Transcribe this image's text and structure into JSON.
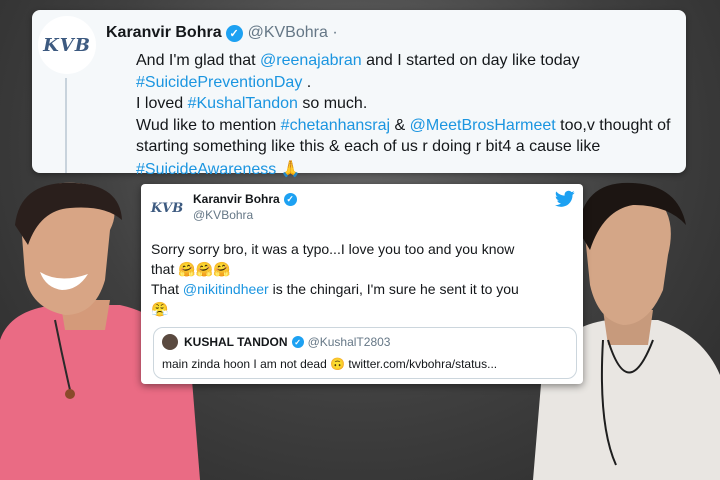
{
  "tweet_top": {
    "avatar_text": "KVB",
    "name": "Karanvir Bohra",
    "handle": "@KVBohra ·",
    "line1_a": "And I'm glad that ",
    "line1_mention": "@reenajabran",
    "line1_b": " and I started on day like today",
    "line2_hashtag": "#SuicidePreventionDay",
    "line2_b": " .",
    "line3_a": "I loved ",
    "line3_hashtag": "#KushalTandon",
    "line3_b": " so much.",
    "line4_a": "Wud like to mention ",
    "line4_hashtag": "#chetanhansraj",
    "line4_b": " & ",
    "line4_mention": "@MeetBrosHarmeet",
    "line4_c": " too,v thought of",
    "line5": "starting something like this & each of us r doing r bit4 a cause like",
    "line6_hashtag": "#SuicideAwareness",
    "line6_emoji": "🙏"
  },
  "tweet_mid": {
    "avatar_text": "KVB",
    "name": "Karanvir Bohra",
    "handle": "@KVBohra",
    "line1": "Sorry sorry bro, it was a typo...I love you too and you know",
    "line2_a": "that ",
    "line2_emojis": "🤗🤗🤗",
    "line3_a": "That ",
    "line3_mention": "@nikitindheer",
    "line3_b": " is the chingari, I'm sure he sent it to you",
    "line4_emoji": "😤",
    "quote": {
      "name": "KUSHAL TANDON",
      "handle": "@KushalT2803",
      "text": "main zinda hoon I am not dead 🙃 twitter.com/kvbohra/status..."
    }
  },
  "colors": {
    "link": "#1b95e0",
    "verified": "#1da1f2",
    "twitter_blue": "#1da1f2",
    "background": "#3f3f3f",
    "left_shirt": "#e8627a"
  },
  "icons": [
    "verified-badge-icon",
    "twitter-bird-icon",
    "folded-hands-emoji",
    "hugging-face-emoji",
    "upside-down-face-emoji"
  ]
}
